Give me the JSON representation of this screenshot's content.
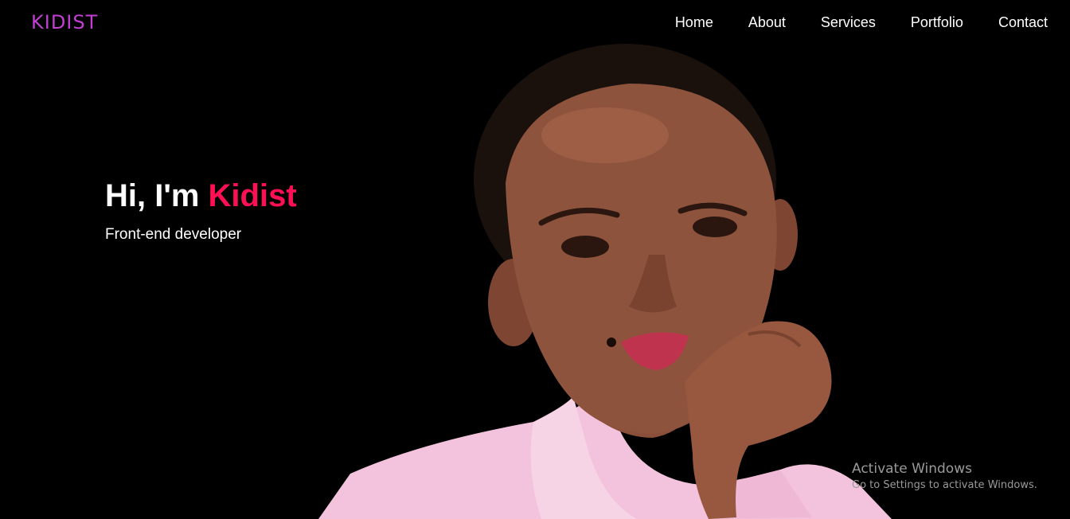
{
  "logo": {
    "text": "KIDIST"
  },
  "nav": {
    "items": [
      {
        "label": "Home"
      },
      {
        "label": "About"
      },
      {
        "label": "Services"
      },
      {
        "label": "Portfolio"
      },
      {
        "label": "Contact"
      }
    ]
  },
  "hero": {
    "greeting": "Hi, I'm ",
    "name": "Kidist",
    "subtitle": "Front-end developer"
  },
  "watermark": {
    "title": "Activate Windows",
    "subtitle": "Go to Settings to activate Windows."
  },
  "colors": {
    "background": "#000000",
    "logo": "#c13fd2",
    "accent_name": "#ff0f54",
    "text": "#ffffff",
    "shirt": "#f3c3dd"
  }
}
